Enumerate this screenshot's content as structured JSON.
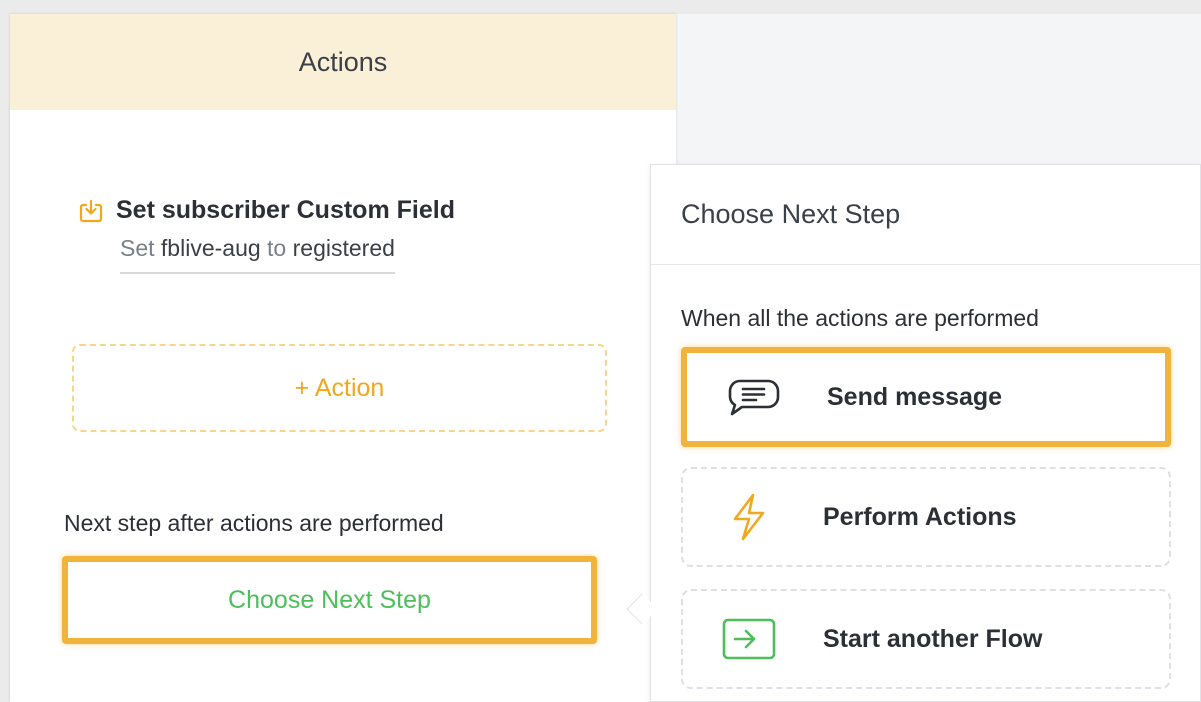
{
  "actions_card": {
    "header_title": "Actions",
    "action_item": {
      "title": "Set subscriber Custom Field",
      "detail_prefix": "Set",
      "field_name": "fblive-aug",
      "detail_mid": "to",
      "field_value": "registered",
      "icon": "download-icon"
    },
    "add_action_label": "+ Action",
    "next_step_label": "Next step after actions are performed",
    "choose_next_step_label": "Choose Next Step"
  },
  "next_step_panel": {
    "title": "Choose Next Step",
    "subtitle": "When all the actions are performed",
    "options": [
      {
        "label": "Send message",
        "icon": "chat-bubble-icon",
        "highlighted": true
      },
      {
        "label": "Perform Actions",
        "icon": "lightning-icon",
        "highlighted": false
      },
      {
        "label": "Start another Flow",
        "icon": "enter-flow-icon",
        "highlighted": false
      }
    ]
  },
  "colors": {
    "header_bg": "#faf0d8",
    "highlight": "#f0b43c",
    "accent_orange": "#f2a81d",
    "accent_green": "#4cbf5a"
  }
}
